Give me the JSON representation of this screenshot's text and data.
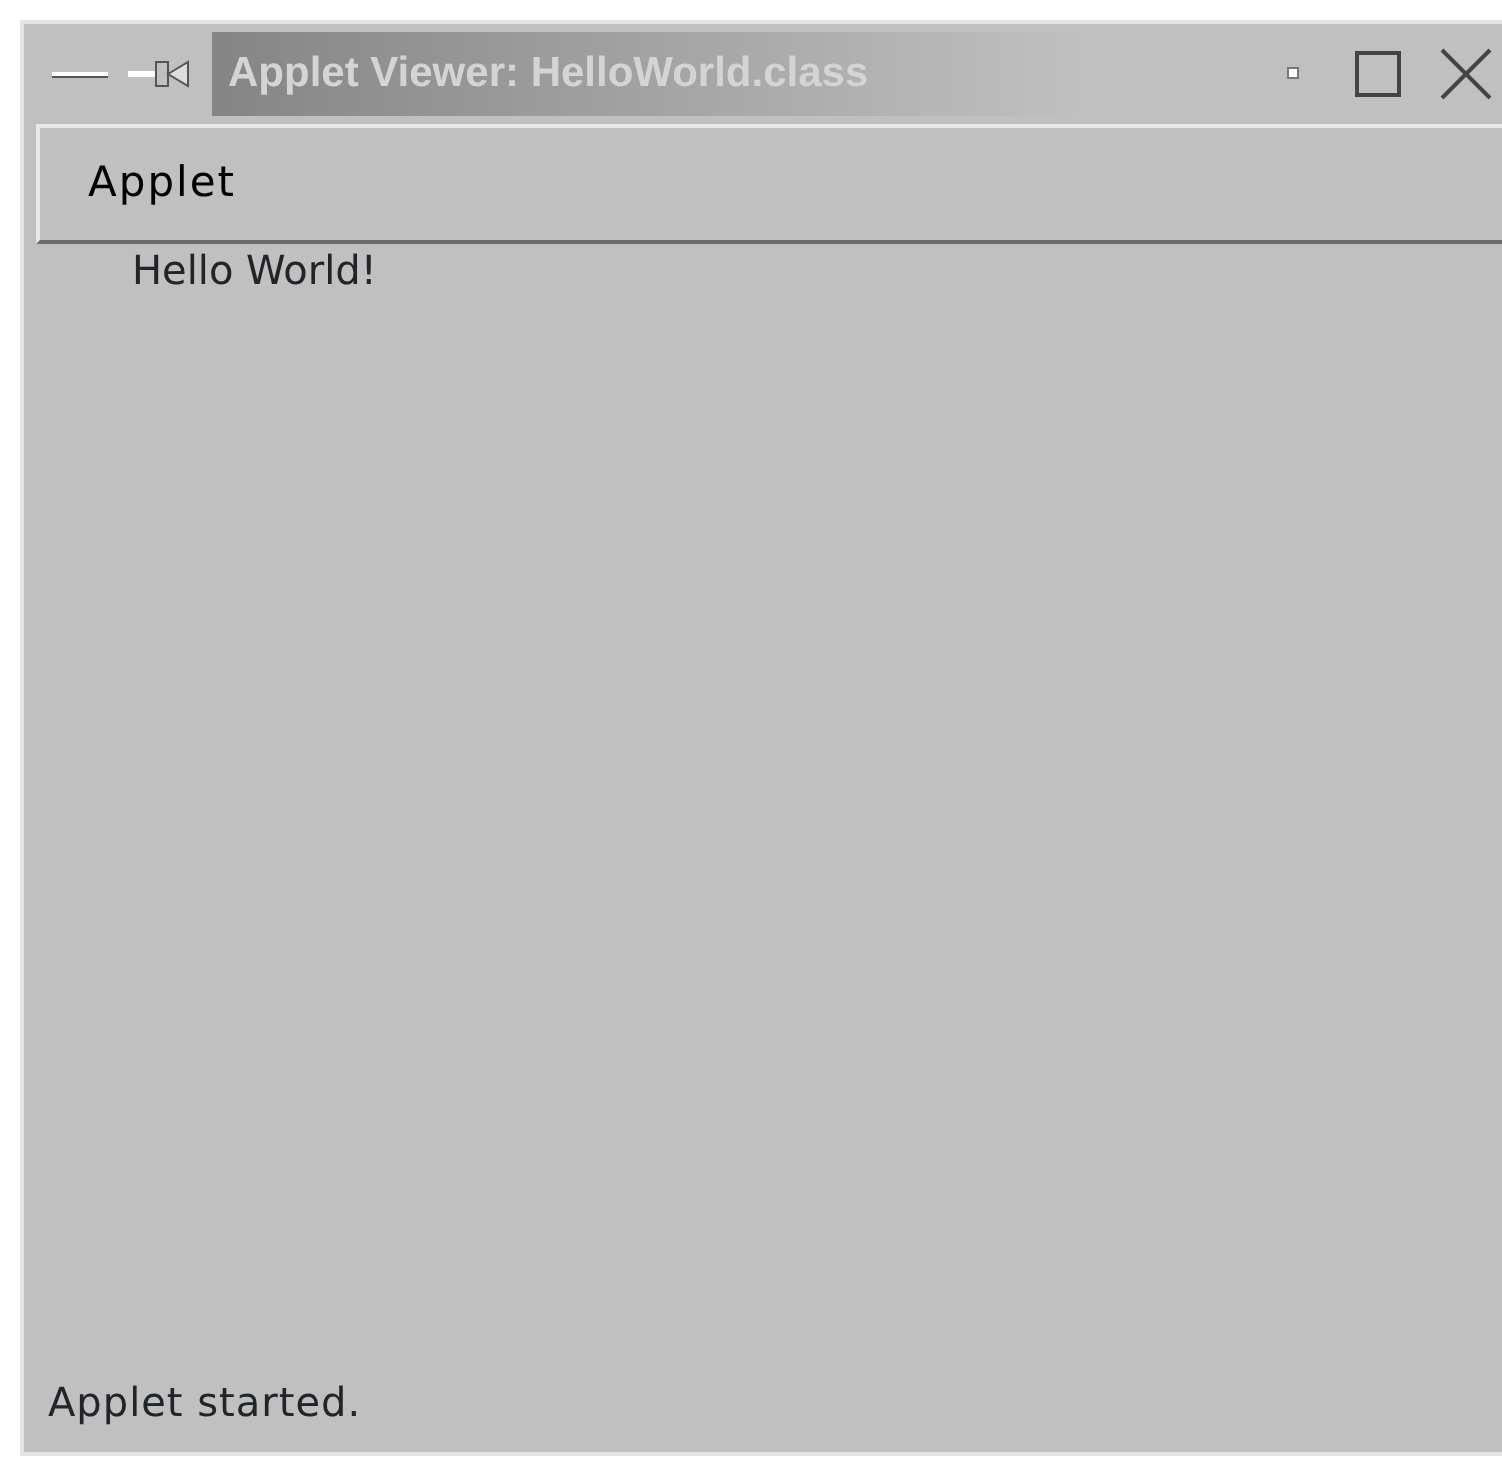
{
  "window": {
    "title": "Applet Viewer: HelloWorld.class"
  },
  "menu_bar": [
    {
      "label": "Applet"
    }
  ],
  "content": {
    "text": "Hello World!"
  },
  "status_bar": "Applet started."
}
